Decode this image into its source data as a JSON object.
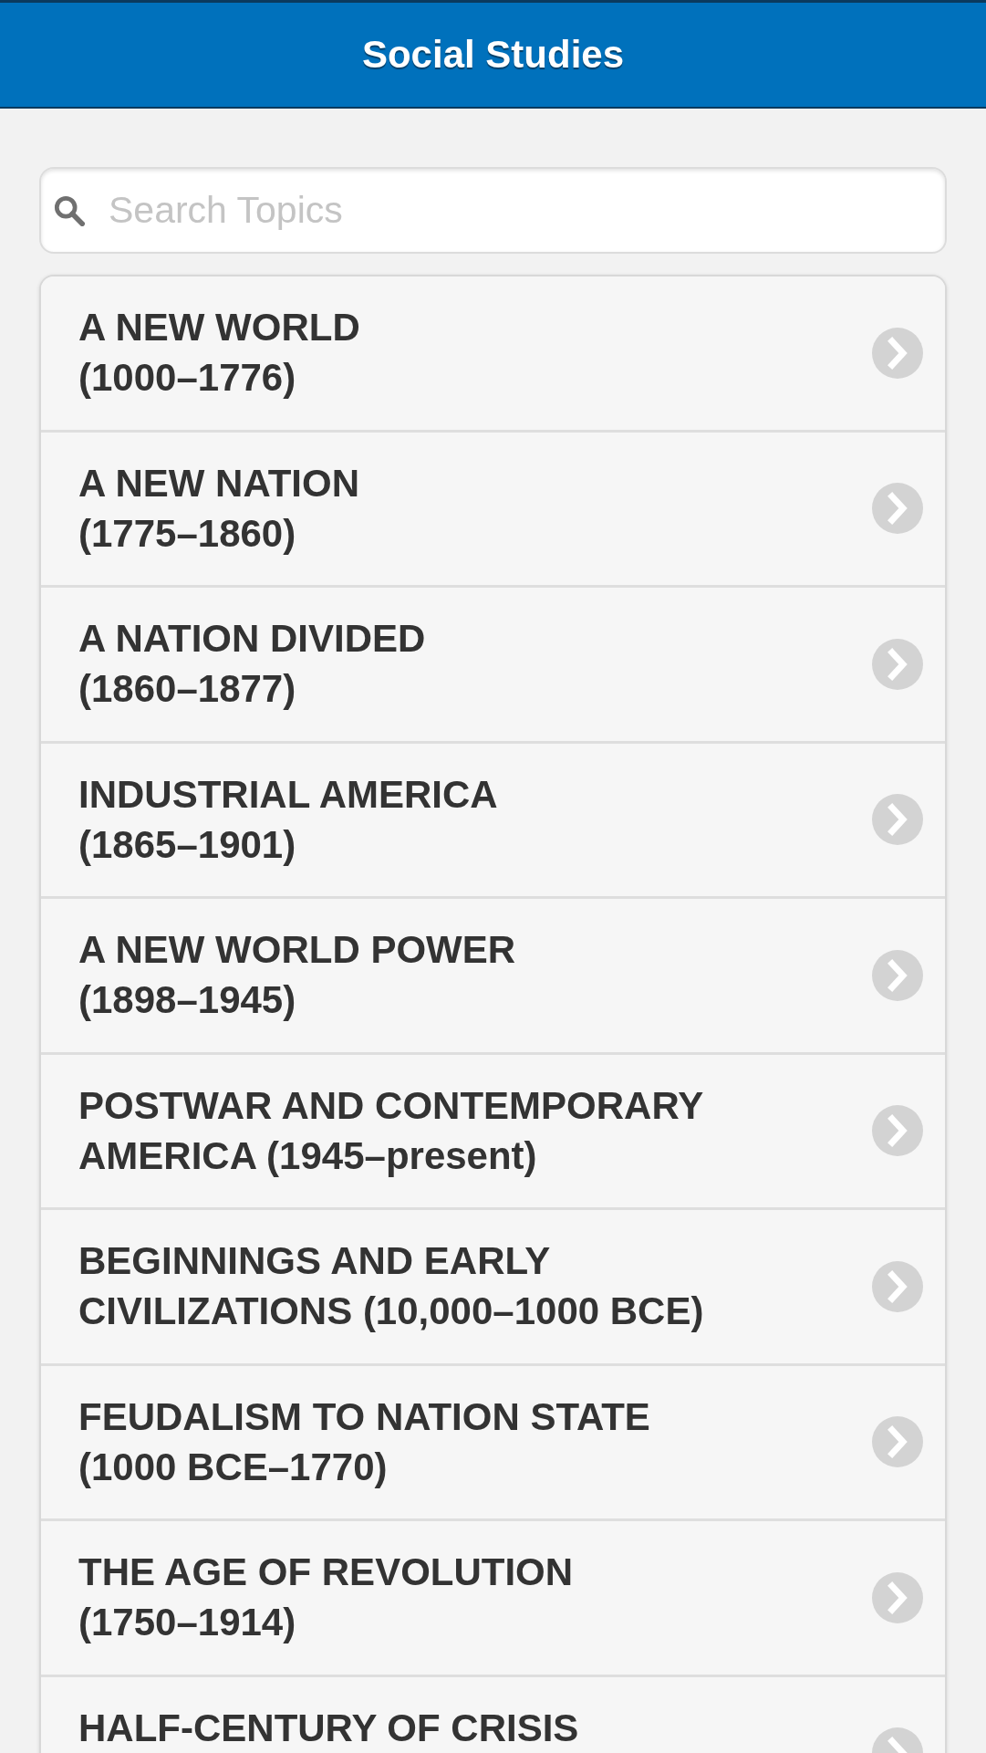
{
  "header": {
    "title": "Social Studies"
  },
  "search": {
    "placeholder": "Search Topics"
  },
  "topics": [
    {
      "lines": [
        "A NEW WORLD",
        "(1000–1776)"
      ]
    },
    {
      "lines": [
        "A NEW NATION",
        "(1775–1860)"
      ]
    },
    {
      "lines": [
        "A NATION DIVIDED",
        "(1860–1877)"
      ]
    },
    {
      "lines": [
        "INDUSTRIAL AMERICA",
        "(1865–1901)"
      ]
    },
    {
      "lines": [
        "A NEW WORLD POWER",
        "(1898–1945)"
      ]
    },
    {
      "lines": [
        "POSTWAR AND CONTEMPORARY",
        "AMERICA (1945–present)"
      ]
    },
    {
      "lines": [
        "BEGINNINGS AND EARLY",
        "CIVILIZATIONS (10,000–1000 BCE)"
      ]
    },
    {
      "lines": [
        "FEUDALISM TO NATION STATE",
        "(1000 BCE–1770)"
      ]
    },
    {
      "lines": [
        "THE AGE OF REVOLUTION",
        "(1750–1914)"
      ]
    },
    {
      "lines": [
        "HALF-CENTURY OF CRISIS"
      ]
    }
  ]
}
